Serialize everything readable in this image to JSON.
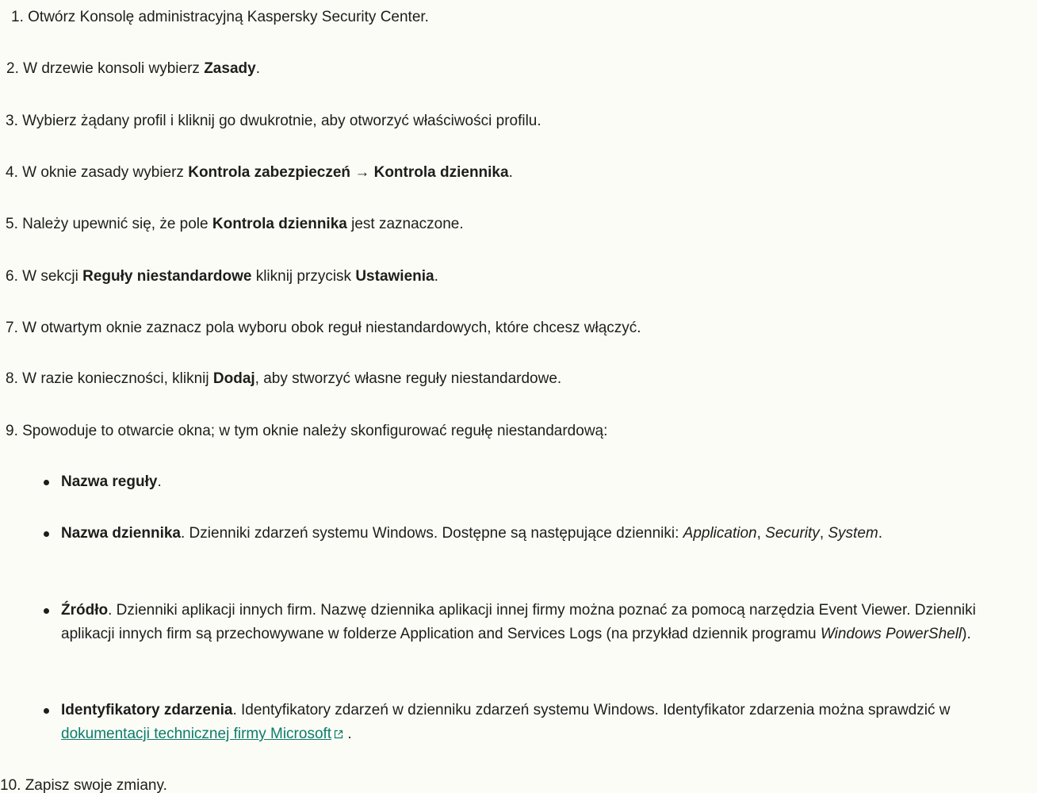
{
  "steps": [
    {
      "num": "1.",
      "parts": [
        {
          "t": " Otwórz Konsolę administracyjną Kaspersky Security Center."
        }
      ]
    },
    {
      "num": "2.",
      "parts": [
        {
          "t": " W drzewie konsoli wybierz "
        },
        {
          "b": "Zasady"
        },
        {
          "t": "."
        }
      ]
    },
    {
      "num": "3.",
      "parts": [
        {
          "t": " Wybierz żądany profil i kliknij go dwukrotnie, aby otworzyć właściwości profilu."
        }
      ]
    },
    {
      "num": "4.",
      "parts": [
        {
          "t": " W oknie zasady wybierz "
        },
        {
          "b": "Kontrola zabezpieczeń"
        },
        {
          "t": " → "
        },
        {
          "b": "Kontrola dziennika"
        },
        {
          "t": "."
        }
      ]
    },
    {
      "num": "5.",
      "parts": [
        {
          "t": " Należy upewnić się, że pole "
        },
        {
          "b": "Kontrola dziennika"
        },
        {
          "t": " jest zaznaczone."
        }
      ]
    },
    {
      "num": "6.",
      "parts": [
        {
          "t": " W sekcji "
        },
        {
          "b": "Reguły niestandardowe"
        },
        {
          "t": " kliknij przycisk "
        },
        {
          "b": "Ustawienia"
        },
        {
          "t": "."
        }
      ]
    },
    {
      "num": "7.",
      "parts": [
        {
          "t": " W otwartym oknie zaznacz pola wyboru obok reguł niestandardowych, które chcesz włączyć."
        }
      ]
    },
    {
      "num": "8.",
      "parts": [
        {
          "t": " W razie konieczności, kliknij "
        },
        {
          "b": "Dodaj"
        },
        {
          "t": ", aby stworzyć własne reguły niestandardowe."
        }
      ]
    },
    {
      "num": "9.",
      "parts": [
        {
          "t": " Spowoduje to otwarcie okna; w tym oknie należy skonfigurować regułę niestandardową:"
        }
      ]
    },
    {
      "num": "10.",
      "parts": [
        {
          "t": " Zapisz swoje zmiany."
        }
      ]
    }
  ],
  "bullets": [
    {
      "parts": [
        {
          "b": "Nazwa reguły"
        },
        {
          "t": "."
        }
      ]
    },
    {
      "parts": [
        {
          "b": "Nazwa dziennika"
        },
        {
          "t": ". Dzienniki zdarzeń systemu Windows. Dostępne są następujące dzienniki: "
        },
        {
          "i": "Application"
        },
        {
          "t": ", "
        },
        {
          "i": "Security"
        },
        {
          "t": ", "
        },
        {
          "i": "System"
        },
        {
          "t": "."
        }
      ]
    },
    {
      "parts": [
        {
          "b": "Źródło"
        },
        {
          "t": ". Dzienniki aplikacji innych firm. Nazwę dziennika aplikacji innej firmy można poznać za pomocą narzędzia Event Viewer. Dzienniki aplikacji innych firm są przechowywane w folderze Application and Services Logs (na przykład dziennik programu "
        },
        {
          "i": "Windows PowerShell"
        },
        {
          "t": ")."
        }
      ]
    },
    {
      "parts": [
        {
          "b": "Identyfikatory zdarzenia"
        },
        {
          "t": ". Identyfikatory zdarzeń w dzienniku zdarzeń systemu Windows. Identyfikator zdarzenia można sprawdzić w "
        },
        {
          "link": "dokumentacji technicznej firmy Microsoft"
        },
        {
          "t": " ."
        }
      ]
    }
  ],
  "colors": {
    "text": "#1d1d1b",
    "link": "#0b7c6a",
    "background": "#fcfcf7"
  },
  "icons": {
    "external_link": "external-link-icon"
  }
}
